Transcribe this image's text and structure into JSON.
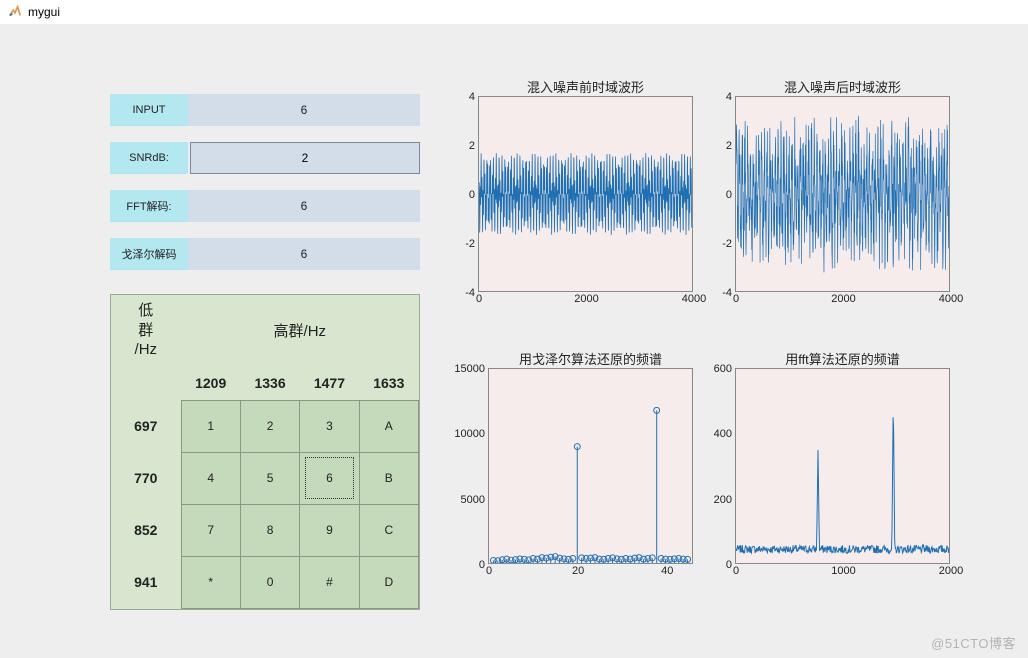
{
  "window": {
    "title": "mygui"
  },
  "fields": {
    "input_label": "INPUT",
    "input_value": "6",
    "snr_label": "SNRdB:",
    "snr_value": "2",
    "fft_label": "FFT解码:",
    "fft_value": "6",
    "goertzel_label": "戈泽尔解码",
    "goertzel_value": "6"
  },
  "keypad": {
    "corner_low": "低",
    "corner_group": "群",
    "corner_hz": "/Hz",
    "top_header": "高群/Hz",
    "cols": [
      "1209",
      "1336",
      "1477",
      "1633"
    ],
    "rows": [
      "697",
      "770",
      "852",
      "941"
    ],
    "keys": [
      [
        "1",
        "2",
        "3",
        "A"
      ],
      [
        "4",
        "5",
        "6",
        "B"
      ],
      [
        "7",
        "8",
        "9",
        "C"
      ],
      [
        "*",
        "0",
        "#",
        "D"
      ]
    ],
    "selected_key": "6"
  },
  "watermark": "@51CTO博客",
  "chart_data": [
    {
      "type": "line",
      "title": "混入噪声前时域波形",
      "xlim": [
        0,
        4000
      ],
      "ylim": [
        -4,
        4
      ],
      "xticks": [
        0,
        2000,
        4000
      ],
      "yticks": [
        -4,
        -2,
        0,
        2,
        4
      ],
      "note": "clean DTMF tone, amplitude approx ±1.7"
    },
    {
      "type": "line",
      "title": "混入噪声后时域波形",
      "xlim": [
        0,
        4000
      ],
      "ylim": [
        -4,
        4
      ],
      "xticks": [
        0,
        2000,
        4000
      ],
      "yticks": [
        -4,
        -2,
        0,
        2,
        4
      ],
      "note": "noisy DTMF tone, amplitude approx ±3.5"
    },
    {
      "type": "stem",
      "title": "用戈泽尔算法还原的频谱",
      "xlim": [
        0,
        46
      ],
      "ylim": [
        0,
        15000
      ],
      "xticks": [
        0,
        20,
        40
      ],
      "yticks": [
        0,
        5000,
        10000,
        15000
      ],
      "series": [
        {
          "name": "goertzel",
          "values": [
            {
              "x": 1,
              "y": 200
            },
            {
              "x": 2,
              "y": 180
            },
            {
              "x": 3,
              "y": 250
            },
            {
              "x": 4,
              "y": 300
            },
            {
              "x": 5,
              "y": 220
            },
            {
              "x": 6,
              "y": 260
            },
            {
              "x": 7,
              "y": 310
            },
            {
              "x": 8,
              "y": 280
            },
            {
              "x": 9,
              "y": 240
            },
            {
              "x": 10,
              "y": 350
            },
            {
              "x": 11,
              "y": 300
            },
            {
              "x": 12,
              "y": 420
            },
            {
              "x": 13,
              "y": 380
            },
            {
              "x": 14,
              "y": 450
            },
            {
              "x": 15,
              "y": 500
            },
            {
              "x": 16,
              "y": 380
            },
            {
              "x": 17,
              "y": 320
            },
            {
              "x": 18,
              "y": 280
            },
            {
              "x": 19,
              "y": 350
            },
            {
              "x": 20,
              "y": 9000
            },
            {
              "x": 21,
              "y": 400
            },
            {
              "x": 22,
              "y": 350
            },
            {
              "x": 23,
              "y": 380
            },
            {
              "x": 24,
              "y": 420
            },
            {
              "x": 25,
              "y": 300
            },
            {
              "x": 26,
              "y": 280
            },
            {
              "x": 27,
              "y": 350
            },
            {
              "x": 28,
              "y": 400
            },
            {
              "x": 29,
              "y": 320
            },
            {
              "x": 30,
              "y": 280
            },
            {
              "x": 31,
              "y": 350
            },
            {
              "x": 32,
              "y": 300
            },
            {
              "x": 33,
              "y": 380
            },
            {
              "x": 34,
              "y": 420
            },
            {
              "x": 35,
              "y": 300
            },
            {
              "x": 36,
              "y": 350
            },
            {
              "x": 37,
              "y": 400
            },
            {
              "x": 38,
              "y": 11800
            },
            {
              "x": 39,
              "y": 350
            },
            {
              "x": 40,
              "y": 300
            },
            {
              "x": 41,
              "y": 280
            },
            {
              "x": 42,
              "y": 320
            },
            {
              "x": 43,
              "y": 350
            },
            {
              "x": 44,
              "y": 300
            },
            {
              "x": 45,
              "y": 280
            }
          ]
        }
      ]
    },
    {
      "type": "line",
      "title": "用fft算法还原的频谱",
      "xlim": [
        0,
        2000
      ],
      "ylim": [
        0,
        600
      ],
      "xticks": [
        0,
        1000,
        2000
      ],
      "yticks": [
        0,
        200,
        400,
        600
      ],
      "series": [
        {
          "name": "fft",
          "peaks": [
            {
              "x": 770,
              "y": 350
            },
            {
              "x": 1477,
              "y": 520
            }
          ],
          "baseline": 30
        }
      ]
    }
  ]
}
